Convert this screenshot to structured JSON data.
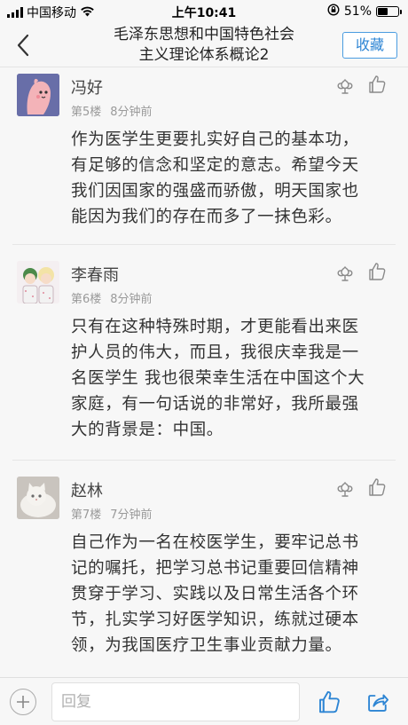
{
  "status_bar": {
    "carrier": "中国移动",
    "time": "上午10:41",
    "battery_text": "51%",
    "battery_level": 0.51
  },
  "nav": {
    "title_line1": "毛泽东思想和中国特色社会",
    "title_line2": "主义理论体系概论2",
    "favorite_label": "收藏"
  },
  "comments": [
    {
      "name": "冯好",
      "floor": "第5楼",
      "time": "8分钟前",
      "avatar": "pink-cartoon-avatar",
      "lines": [
        "作为医学生更要扎实好自己的基本功，",
        "有足够的信念和坚定的意志。希望今天",
        "我们因国家的强盛而骄傲，明天国家也",
        "能因为我们的存在而多了一抹色彩。"
      ]
    },
    {
      "name": "李春雨",
      "floor": "第6楼",
      "time": "8分钟前",
      "avatar": "anime-couple-avatar",
      "lines": [
        "只有在这种特殊时期，才更能看出来医",
        "护人员的伟大，而且，我很庆幸我是一",
        "名医学生 我也很荣幸生活在中国这个大",
        "家庭，有一句话说的非常好，我所最强",
        "大的背景是：中国。"
      ]
    },
    {
      "name": "赵林",
      "floor": "第7楼",
      "time": "7分钟前",
      "avatar": "white-cat-avatar",
      "lines": [
        "自己作为一名在校医学生，要牢记总书",
        "记的嘱托，把学习总书记重要回信精神",
        "贯穿于学习、实践以及日常生活各个环",
        "节，扎实学习好医学知识，练就过硬本",
        "领，为我国医疗卫生事业贡献力量。"
      ]
    }
  ],
  "bottom_bar": {
    "reply_placeholder": "回复"
  },
  "colors": {
    "accent": "#2d85d4",
    "background": "#f7f7f7",
    "text": "#333333",
    "meta": "#9a9a9a"
  },
  "icons": [
    "back-arrow-icon",
    "flower-icon",
    "thumbs-up-icon",
    "plus-icon",
    "share-icon",
    "wifi-icon",
    "lock-rotation-icon"
  ]
}
